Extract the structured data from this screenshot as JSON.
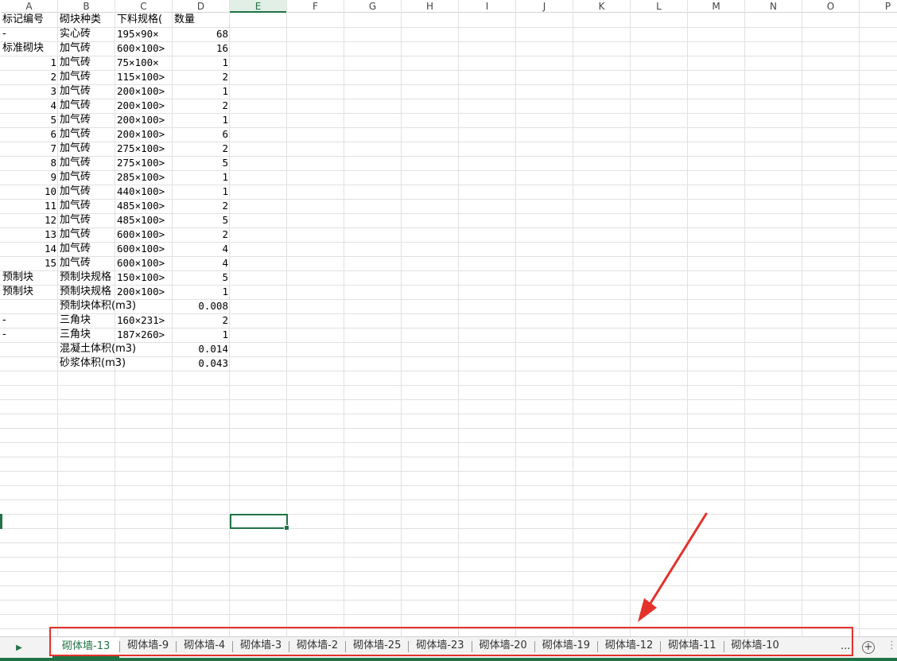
{
  "columns": [
    "A",
    "B",
    "C",
    "D",
    "E",
    "F",
    "G",
    "H",
    "I",
    "J",
    "K",
    "L",
    "M",
    "N",
    "O",
    "P"
  ],
  "active_column": "E",
  "header_row": [
    "标记编号",
    "砌块种类",
    "下料规格(",
    "数量"
  ],
  "rows": [
    [
      "-",
      "实心砖",
      "195×90×",
      "68"
    ],
    [
      "标准砌块",
      "加气砖",
      "600×100>",
      "16"
    ],
    [
      "1",
      "加气砖",
      "75×100×",
      "1"
    ],
    [
      "2",
      "加气砖",
      "115×100>",
      "2"
    ],
    [
      "3",
      "加气砖",
      "200×100>",
      "1"
    ],
    [
      "4",
      "加气砖",
      "200×100>",
      "2"
    ],
    [
      "5",
      "加气砖",
      "200×100>",
      "1"
    ],
    [
      "6",
      "加气砖",
      "200×100>",
      "6"
    ],
    [
      "7",
      "加气砖",
      "275×100>",
      "2"
    ],
    [
      "8",
      "加气砖",
      "275×100>",
      "5"
    ],
    [
      "9",
      "加气砖",
      "285×100>",
      "1"
    ],
    [
      "10",
      "加气砖",
      "440×100>",
      "1"
    ],
    [
      "11",
      "加气砖",
      "485×100>",
      "2"
    ],
    [
      "12",
      "加气砖",
      "485×100>",
      "5"
    ],
    [
      "13",
      "加气砖",
      "600×100>",
      "2"
    ],
    [
      "14",
      "加气砖",
      "600×100>",
      "4"
    ],
    [
      "15",
      "加气砖",
      "600×100>",
      "4"
    ],
    [
      "预制块",
      "预制块规格",
      "150×100>",
      "5"
    ],
    [
      "预制块",
      "预制块规格",
      "200×100>",
      "1"
    ],
    [
      "",
      "预制块体积(m3)",
      "",
      "0.008"
    ],
    [
      "-",
      "三角块",
      "160×231>",
      "2"
    ],
    [
      "-",
      "三角块",
      "187×260>",
      "1"
    ],
    [
      "",
      "混凝土体积(m3)",
      "",
      "0.014"
    ],
    [
      "",
      "砂浆体积(m3)",
      "",
      "0.043"
    ]
  ],
  "tabs": [
    "砌体墙-13",
    "砌体墙-9",
    "砌体墙-4",
    "砌体墙-3",
    "砌体墙-2",
    "砌体墙-25",
    "砌体墙-23",
    "砌体墙-20",
    "砌体墙-19",
    "砌体墙-12",
    "砌体墙-11",
    "砌体墙-10"
  ],
  "active_tab": 0,
  "more_tabs_label": "...",
  "add_sheet_icon": "plus-circle-icon",
  "scroll_icon": "triangle-right-icon",
  "colors": {
    "accent": "#217346",
    "annotation": "#e4322b",
    "grid": "#e1e1e1"
  }
}
